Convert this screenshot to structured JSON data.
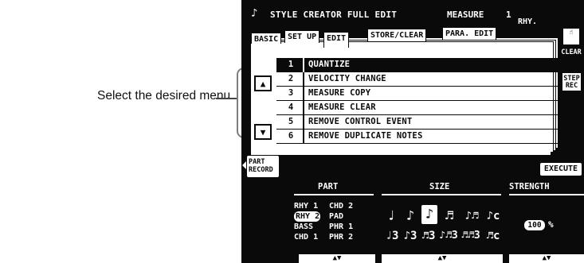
{
  "annotation": {
    "caption": "Select the desired menu."
  },
  "header": {
    "icon": "music-icon",
    "title": "STYLE CREATOR FULL EDIT",
    "measure_label": "MEASURE",
    "measure_value": "1",
    "part_short": "RHY."
  },
  "tabs": [
    {
      "label": "BASIC"
    },
    {
      "label": "SET UP"
    },
    {
      "label": "EDIT",
      "active": true
    },
    {
      "label": "STORE/CLEAR"
    },
    {
      "label": "PARA. EDIT"
    }
  ],
  "scroll": {
    "up_icon": "up-triangle-icon",
    "down_icon": "down-triangle-icon"
  },
  "menu": {
    "items": [
      {
        "num": "1",
        "label": "QUANTIZE",
        "selected": true
      },
      {
        "num": "2",
        "label": "VELOCITY CHANGE"
      },
      {
        "num": "3",
        "label": "MEASURE COPY"
      },
      {
        "num": "4",
        "label": "MEASURE CLEAR"
      },
      {
        "num": "5",
        "label": "REMOVE CONTROL EVENT"
      },
      {
        "num": "6",
        "label": "REMOVE DUPLICATE NOTES"
      }
    ]
  },
  "side_buttons": {
    "clear_label": "CLEAR",
    "step_line1": "STEP",
    "step_line2": "REC"
  },
  "bottom": {
    "part_record_line1": "PART",
    "part_record_line2": "RECORD",
    "execute_label": "EXECUTE",
    "columns": {
      "part": "PART",
      "size": "SIZE",
      "strength": "STRENGTH"
    },
    "parts": [
      [
        "RHY 1",
        "CHD 2"
      ],
      [
        "RHY 2",
        "PAD"
      ],
      [
        "BASS",
        "PHR 1"
      ],
      [
        "CHD 1",
        "PHR 2"
      ]
    ],
    "selected_part": "RHY 2",
    "sizes_row1": [
      "♩",
      "♪",
      "♪",
      "♬",
      "♪♬",
      "♪c"
    ],
    "sizes_row2": [
      "♩3",
      "♪3",
      "♬3",
      "♪♬3",
      "♬♬3",
      "♬c"
    ],
    "selected_size_index": 2,
    "strength_value": "100",
    "strength_unit": "%",
    "knob_arrows": "▲▼"
  }
}
